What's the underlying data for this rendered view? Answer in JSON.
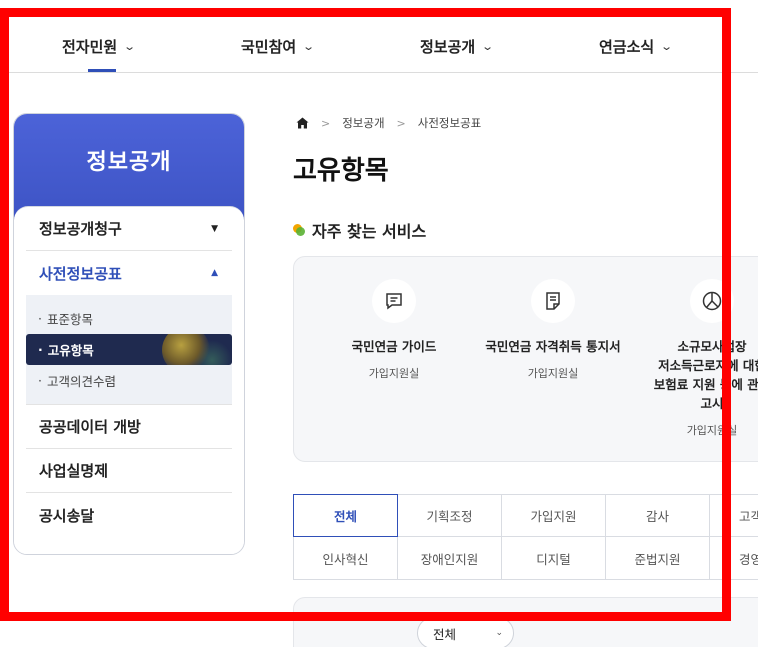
{
  "topnav": {
    "items": [
      {
        "label": "전자민원"
      },
      {
        "label": "국민참여"
      },
      {
        "label": "정보공개"
      },
      {
        "label": "연금소식"
      }
    ],
    "chevron": "⌄"
  },
  "sidebar": {
    "title": "정보공개",
    "items": [
      {
        "label": "정보공개청구",
        "caret": "▼"
      },
      {
        "label": "사전정보공표",
        "caret": "▲"
      },
      {
        "label": "공공데이터 개방"
      },
      {
        "label": "사업실명제"
      },
      {
        "label": "공시송달"
      }
    ],
    "subitems": [
      {
        "label": "표준항목"
      },
      {
        "label": "고유항목"
      },
      {
        "label": "고객의견수렴"
      }
    ],
    "dot": "·"
  },
  "breadcrumb": {
    "items": [
      "정보공개",
      "사전정보공표"
    ],
    "separator": ">"
  },
  "page_title": "고유항목",
  "services": {
    "title": "자주 찾는 서비스",
    "items": [
      {
        "name": "국민연금 가이드",
        "dept": "가입지원실",
        "icon": "message-icon"
      },
      {
        "name": "국민연금 자격취득 통지서",
        "dept": "가입지원실",
        "icon": "document-icon"
      },
      {
        "name_lines": [
          "소규모사업장",
          "저소득근로자에 대한",
          "보험료 지원 등에 관한",
          "고시"
        ],
        "dept": "가입지원실",
        "icon": "pie-chart-icon"
      }
    ]
  },
  "tabs": {
    "row1": [
      "전체",
      "기획조정",
      "가입지원",
      "감사",
      "고객"
    ],
    "row2": [
      "인사혁신",
      "장애인지원",
      "디지털",
      "준법지원",
      "경영"
    ]
  },
  "filter": {
    "selected": "전체",
    "chevron": "⌄"
  },
  "colors": {
    "accent": "#2f4fb8",
    "sidebar_header": "#4c63d8",
    "selected_sub": "#1f2a4f",
    "frame": "#ff0000"
  }
}
